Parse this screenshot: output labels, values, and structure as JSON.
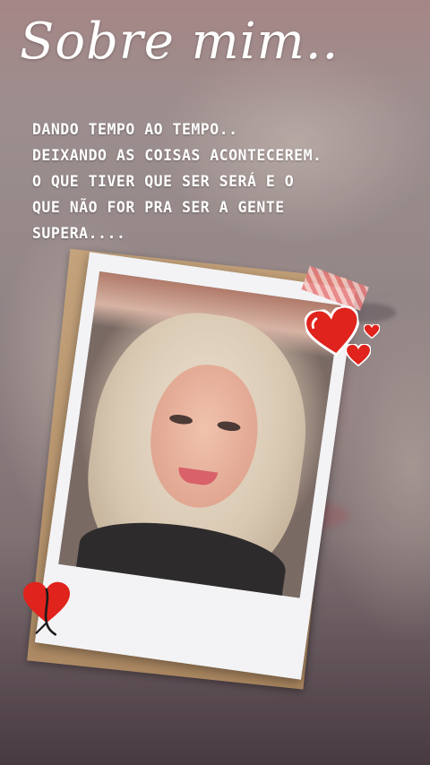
{
  "story": {
    "title": "Sobre mim..",
    "bio_lines": [
      "DANDO TEMPO AO TEMPO..",
      "DEIXANDO AS COISAS ACONTECEREM.",
      "O QUE TIVER QUE SER SERÁ E O",
      "QUE NÃO FOR PRA SER A GENTE",
      "SUPERA...."
    ]
  },
  "stickers": {
    "icons": [
      "heart-icon",
      "heart-icon",
      "heart-icon",
      "heart-icon"
    ],
    "heart_color": "#e0231c"
  },
  "colors": {
    "text": "#ffffff",
    "polaroid_frame": "#f3f3f5",
    "kraft_paper": "#b8936b"
  }
}
